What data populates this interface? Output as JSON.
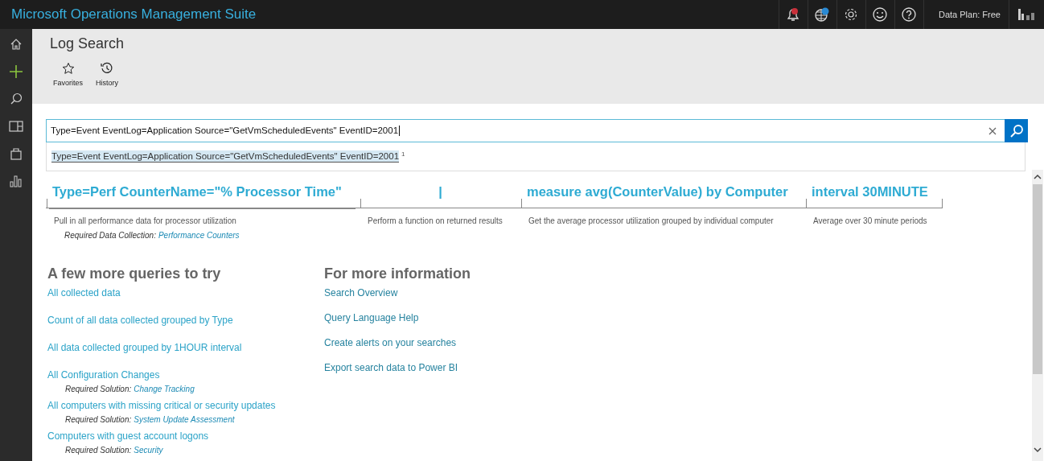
{
  "app_title": "Microsoft Operations Management Suite",
  "top_bar": {
    "data_plan_label": "Data Plan:",
    "data_plan_value": "Free"
  },
  "page_title": "Log Search",
  "toolbar": [
    {
      "kind": "favorites",
      "label": "Favorites"
    },
    {
      "kind": "history",
      "label": "History"
    }
  ],
  "search": {
    "value": "Type=Event EventLog=Application Source=\"GetVmScheduledEvents\" EventID=2001",
    "suggestions": [
      {
        "text": "Type=Event EventLog=Application Source=\"GetVmScheduledEvents\" EventID=2001",
        "count": "1",
        "selected": true
      }
    ]
  },
  "query_segments": [
    {
      "query": "Type=Perf CounterName=\"% Processor Time\"",
      "description": "Pull in all performance data for processor utilization",
      "requirement": {
        "label": "Required Data Collection:",
        "link": "Performance Counters"
      }
    },
    {
      "query": "|",
      "description": "Perform a function on returned results"
    },
    {
      "query": "measure avg(CounterValue) by Computer",
      "description": "Get the average processor utilization grouped by individual computer"
    },
    {
      "query": "interval 30MINUTE",
      "description": "Average over 30 minute periods"
    }
  ],
  "more_queries": {
    "heading": "A few more queries to try",
    "items": [
      {
        "title": "All collected data"
      },
      {
        "title": "Count of all data collected grouped by Type"
      },
      {
        "title": "All data collected grouped by 1HOUR interval"
      },
      {
        "title": "All Configuration Changes",
        "requirement": {
          "label": "Required Solution:",
          "link": "Change Tracking"
        }
      },
      {
        "title": "All computers with missing critical or security updates",
        "requirement": {
          "label": "Required Solution:",
          "link": "System Update Assessment"
        }
      },
      {
        "title": "Computers with guest account logons",
        "requirement": {
          "label": "Required Solution:",
          "link": "Security"
        }
      }
    ]
  },
  "more_info": {
    "heading": "For more information",
    "links": [
      "Search Overview",
      "Query Language Help",
      "Create alerts on your searches",
      "Export search data to Power BI"
    ]
  }
}
